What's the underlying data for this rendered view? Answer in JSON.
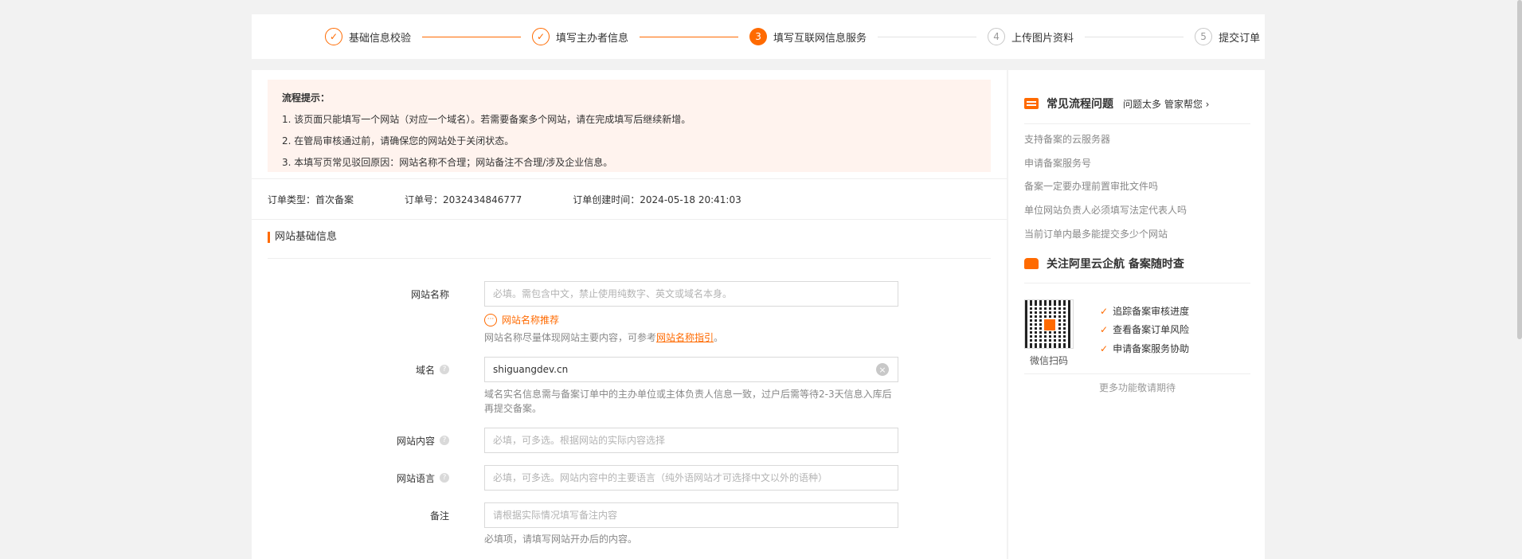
{
  "stepper": {
    "steps": [
      {
        "label": "基础信息校验",
        "mark": "✓",
        "status": "done"
      },
      {
        "label": "填写主办者信息",
        "mark": "✓",
        "status": "done"
      },
      {
        "label": "填写互联网信息服务",
        "mark": "3",
        "status": "active"
      },
      {
        "label": "上传图片资料",
        "mark": "4",
        "status": "todo"
      },
      {
        "label": "提交订单",
        "mark": "5",
        "status": "todo"
      }
    ]
  },
  "tips": {
    "title": "流程提示：",
    "lines": [
      "1. 该页面只能填写一个网站（对应一个域名）。若需要备案多个网站，请在完成填写后继续新增。",
      "2. 在管局审核通过前，请确保您的网站处于关闭状态。",
      "3. 本填写页常见驳回原因：网站名称不合理；网站备注不合理/涉及企业信息。"
    ]
  },
  "order": {
    "type": "订单类型：首次备案",
    "number": "订单号：2032434846777",
    "created": "订单创建时间：2024-05-18 20:41:03"
  },
  "section": {
    "title": "网站基础信息"
  },
  "form": {
    "site_name": {
      "label": "网站名称",
      "placeholder": "必填。需包含中文，禁止使用纯数字、英文或域名本身。",
      "recommend": "网站名称推荐",
      "hint_prefix": "网站名称尽量体现网站主要内容，可参考",
      "hint_link": "网站名称指引",
      "hint_suffix": "。"
    },
    "domain": {
      "label": "域名",
      "value": "shiguangdev.cn",
      "hint": "域名实名信息需与备案订单中的主办单位或主体负责人信息一致，过户后需等待2-3天信息入库后再提交备案。"
    },
    "content": {
      "label": "网站内容",
      "placeholder": "必填，可多选。根据网站的实际内容选择"
    },
    "language": {
      "label": "网站语言",
      "placeholder": "必填，可多选。网站内容中的主要语言（纯外语网站才可选择中文以外的语种）"
    },
    "remark": {
      "label": "备注",
      "placeholder": "请根据实际情况填写备注内容",
      "hint": "必填项，请填写网站开办后的内容。"
    }
  },
  "sidebar": {
    "faq_title": "常见流程问题",
    "faq_sub": "问题太多 管家帮您",
    "faq_links": [
      "支持备案的云服务器",
      "申请备案服务号",
      "备案一定要办理前置审批文件吗",
      "单位网站负责人必须填写法定代表人吗",
      "当前订单内最多能提交多少个网站"
    ],
    "follow_title": "关注阿里云企航 备案随时查",
    "qr_caption": "微信扫码",
    "features": [
      "追踪备案审核进度",
      "查看备案订单风险",
      "申请备案服务协助"
    ],
    "more": "更多功能敬请期待"
  },
  "colors": {
    "accent": "#ff6a00",
    "tips_bg": "#fff3ee"
  }
}
